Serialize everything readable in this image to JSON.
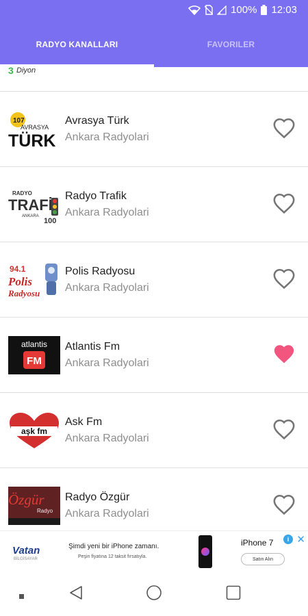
{
  "status_bar": {
    "battery": "100%",
    "time": "12:03"
  },
  "tabs": [
    {
      "label": "RADYO KANALLARI",
      "active": true
    },
    {
      "label": "FAVORILER",
      "active": false
    }
  ],
  "partial_item": {
    "logo_text": "Diyon"
  },
  "stations": [
    {
      "title": "Avrasya Türk",
      "subtitle": "Ankara Radyolari",
      "logo_text": "AVRASYA TÜRK",
      "logo_freq": "107",
      "favorite": false
    },
    {
      "title": "Radyo Trafik",
      "subtitle": "Ankara Radyolari",
      "logo_text": "TRAFİK",
      "logo_small": "RADYO",
      "logo_freq": "100",
      "logo_city": "ANKARA",
      "favorite": false
    },
    {
      "title": "Polis Radyosu",
      "subtitle": "Ankara Radyolari",
      "logo_text": "Polis",
      "logo_small": "Radyosu",
      "logo_freq": "94.1",
      "favorite": false
    },
    {
      "title": "Atlantis Fm",
      "subtitle": "Ankara Radyolari",
      "logo_text": "atlantis",
      "logo_small": "FM",
      "favorite": true
    },
    {
      "title": "Ask Fm",
      "subtitle": "Ankara Radyolari",
      "logo_text": "aşk fm",
      "favorite": false
    },
    {
      "title": "Radyo Özgür",
      "subtitle": "Ankara Radyolari",
      "logo_text": "Özgür",
      "logo_small": "Radyo",
      "favorite": false
    }
  ],
  "ad": {
    "brand": "Vatan",
    "brand_sub": "BİLGİSAYAR",
    "line1": "Şimdi yeni bir iPhone zamanı.",
    "line2": "Peşin fiyatına 12 taksit fırsatıyla.",
    "product": "iPhone 7",
    "button": "Satın Alın",
    "info": "i",
    "close": "✕"
  },
  "colors": {
    "header": "#7a6ff0",
    "favorite": "#f2557e",
    "heart_outline": "#757575"
  }
}
